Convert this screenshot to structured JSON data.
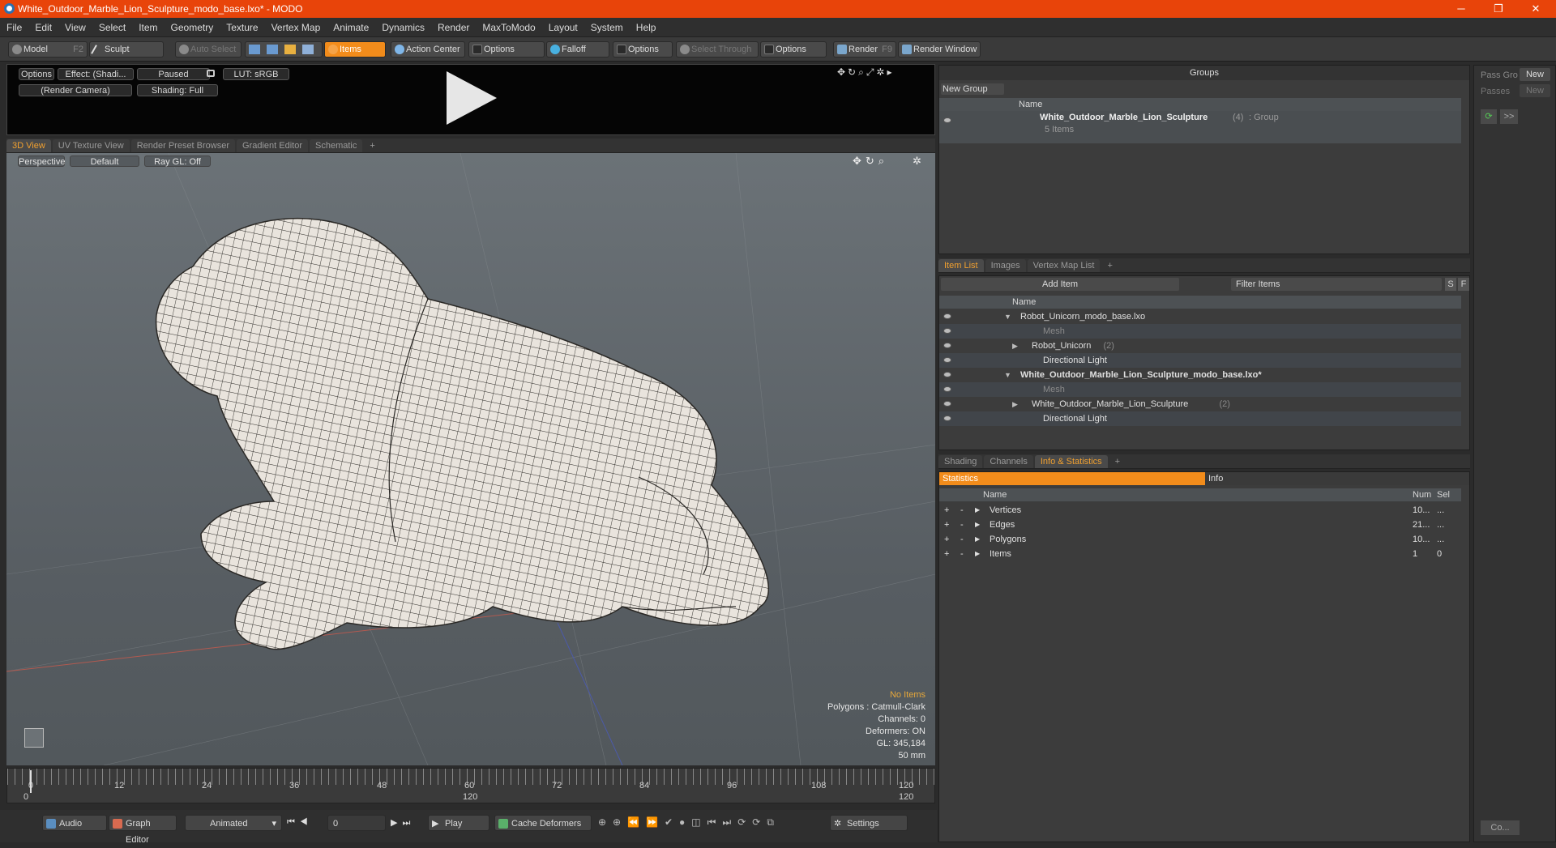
{
  "window": {
    "title": "White_Outdoor_Marble_Lion_Sculpture_modo_base.lxo* - MODO",
    "min": "─",
    "max": "❐",
    "close": "✕"
  },
  "menu": [
    "File",
    "Edit",
    "View",
    "Select",
    "Item",
    "Geometry",
    "Texture",
    "Vertex Map",
    "Animate",
    "Dynamics",
    "Render",
    "MaxToModo",
    "Layout",
    "System",
    "Help"
  ],
  "toolbar": {
    "model": "Model",
    "model_key": "F2",
    "sculpt": "Sculpt",
    "auto_select": "Auto Select",
    "items": "Items",
    "action_center": "Action Center",
    "options1": "Options",
    "falloff": "Falloff",
    "options2": "Options",
    "select_through": "Select Through",
    "options3": "Options",
    "render": "Render",
    "render_key": "F9",
    "render_window": "Render Window"
  },
  "preview": {
    "options": "Options",
    "effect": "Effect: (Shadi...",
    "paused": "Paused",
    "lut": "LUT: sRGB",
    "camera": "(Render Camera)",
    "shading": "Shading: Full"
  },
  "viewport_tabs": [
    "3D View",
    "UV Texture View",
    "Render Preset Browser",
    "Gradient Editor",
    "Schematic",
    "+"
  ],
  "viewport": {
    "perspective": "Perspective",
    "default": "Default",
    "raygl": "Ray GL: Off",
    "info": {
      "no_items": "No Items",
      "polygons": "Polygons : Catmull-Clark",
      "channels": "Channels: 0",
      "deformers": "Deformers: ON",
      "gl": "GL: 345,184",
      "lens": "50 mm"
    }
  },
  "timeline": {
    "ticks": [
      "0",
      "12",
      "24",
      "36",
      "48",
      "60",
      "72",
      "84",
      "96",
      "108",
      "120"
    ],
    "start": "0",
    "mid": "120",
    "end": "120"
  },
  "bottom": {
    "audio": "Audio",
    "graph_editor": "Graph Editor",
    "animated": "Animated",
    "frame": "0",
    "play": "Play",
    "cache": "Cache Deformers",
    "settings": "Settings"
  },
  "groups": {
    "title": "Groups",
    "new_group": "New Group",
    "name_col": "Name",
    "group_name": "White_Outdoor_Marble_Lion_Sculpture",
    "group_count": "(4)",
    "group_type": ": Group",
    "group_items": "5 Items"
  },
  "passes": {
    "pass_label": "Pass Gro",
    "passes_label": "Passes",
    "new1": "New",
    "new2": "New",
    "arrow": ">>"
  },
  "item_list": {
    "tabs": [
      "Item List",
      "Images",
      "Vertex Map List",
      "+"
    ],
    "add_item": "Add Item",
    "filter": "Filter Items",
    "s": "S",
    "f": "F",
    "name_col": "Name",
    "rows": [
      {
        "label": "Robot_Unicorn_modo_base.lxo",
        "count": "",
        "indent": 0,
        "bold": false,
        "dim": false,
        "arrow": "▼"
      },
      {
        "label": "Mesh",
        "count": "",
        "indent": 2,
        "bold": false,
        "dim": true,
        "arrow": ""
      },
      {
        "label": "Robot_Unicorn",
        "count": "(2)",
        "indent": 1,
        "bold": false,
        "dim": false,
        "arrow": "▶"
      },
      {
        "label": "Directional Light",
        "count": "",
        "indent": 2,
        "bold": false,
        "dim": false,
        "arrow": ""
      },
      {
        "label": "White_Outdoor_Marble_Lion_Sculpture_modo_base.lxo*",
        "count": "",
        "indent": 0,
        "bold": true,
        "dim": false,
        "arrow": "▼"
      },
      {
        "label": "Mesh",
        "count": "",
        "indent": 2,
        "bold": false,
        "dim": true,
        "arrow": ""
      },
      {
        "label": "White_Outdoor_Marble_Lion_Sculpture",
        "count": "(2)",
        "indent": 1,
        "bold": false,
        "dim": false,
        "arrow": "▶"
      },
      {
        "label": "Directional Light",
        "count": "",
        "indent": 2,
        "bold": false,
        "dim": false,
        "arrow": ""
      }
    ]
  },
  "stats": {
    "tabs": [
      "Shading",
      "Channels",
      "Info & Statistics",
      "+"
    ],
    "statistics": "Statistics",
    "info": "Info",
    "name_col": "Name",
    "num_col": "Num",
    "sel_col": "Sel",
    "rows": [
      {
        "name": "Vertices",
        "num": "10...",
        "sel": "..."
      },
      {
        "name": "Edges",
        "num": "21...",
        "sel": "..."
      },
      {
        "name": "Polygons",
        "num": "10...",
        "sel": "..."
      },
      {
        "name": "Items",
        "num": "1",
        "sel": "0"
      }
    ]
  },
  "bottom_right": {
    "co": "Co..."
  },
  "colors": {
    "accent": "#f28c1b",
    "titlebar": "#e8440a",
    "viewport": "#5f666b"
  }
}
